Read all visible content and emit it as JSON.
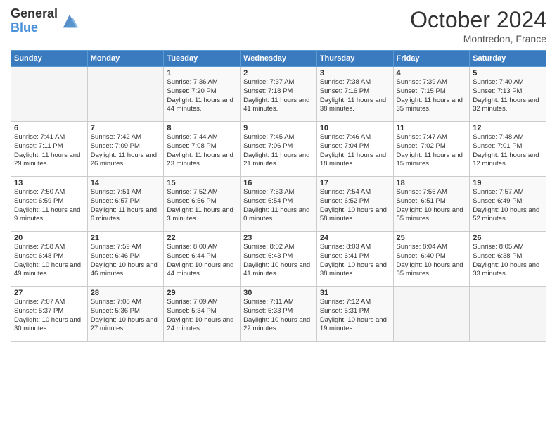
{
  "header": {
    "logo_general": "General",
    "logo_blue": "Blue",
    "title": "October 2024",
    "location": "Montredon, France"
  },
  "days_of_week": [
    "Sunday",
    "Monday",
    "Tuesday",
    "Wednesday",
    "Thursday",
    "Friday",
    "Saturday"
  ],
  "weeks": [
    [
      {
        "day": "",
        "sunrise": "",
        "sunset": "",
        "daylight": ""
      },
      {
        "day": "",
        "sunrise": "",
        "sunset": "",
        "daylight": ""
      },
      {
        "day": "1",
        "sunrise": "Sunrise: 7:36 AM",
        "sunset": "Sunset: 7:20 PM",
        "daylight": "Daylight: 11 hours and 44 minutes."
      },
      {
        "day": "2",
        "sunrise": "Sunrise: 7:37 AM",
        "sunset": "Sunset: 7:18 PM",
        "daylight": "Daylight: 11 hours and 41 minutes."
      },
      {
        "day": "3",
        "sunrise": "Sunrise: 7:38 AM",
        "sunset": "Sunset: 7:16 PM",
        "daylight": "Daylight: 11 hours and 38 minutes."
      },
      {
        "day": "4",
        "sunrise": "Sunrise: 7:39 AM",
        "sunset": "Sunset: 7:15 PM",
        "daylight": "Daylight: 11 hours and 35 minutes."
      },
      {
        "day": "5",
        "sunrise": "Sunrise: 7:40 AM",
        "sunset": "Sunset: 7:13 PM",
        "daylight": "Daylight: 11 hours and 32 minutes."
      }
    ],
    [
      {
        "day": "6",
        "sunrise": "Sunrise: 7:41 AM",
        "sunset": "Sunset: 7:11 PM",
        "daylight": "Daylight: 11 hours and 29 minutes."
      },
      {
        "day": "7",
        "sunrise": "Sunrise: 7:42 AM",
        "sunset": "Sunset: 7:09 PM",
        "daylight": "Daylight: 11 hours and 26 minutes."
      },
      {
        "day": "8",
        "sunrise": "Sunrise: 7:44 AM",
        "sunset": "Sunset: 7:08 PM",
        "daylight": "Daylight: 11 hours and 23 minutes."
      },
      {
        "day": "9",
        "sunrise": "Sunrise: 7:45 AM",
        "sunset": "Sunset: 7:06 PM",
        "daylight": "Daylight: 11 hours and 21 minutes."
      },
      {
        "day": "10",
        "sunrise": "Sunrise: 7:46 AM",
        "sunset": "Sunset: 7:04 PM",
        "daylight": "Daylight: 11 hours and 18 minutes."
      },
      {
        "day": "11",
        "sunrise": "Sunrise: 7:47 AM",
        "sunset": "Sunset: 7:02 PM",
        "daylight": "Daylight: 11 hours and 15 minutes."
      },
      {
        "day": "12",
        "sunrise": "Sunrise: 7:48 AM",
        "sunset": "Sunset: 7:01 PM",
        "daylight": "Daylight: 11 hours and 12 minutes."
      }
    ],
    [
      {
        "day": "13",
        "sunrise": "Sunrise: 7:50 AM",
        "sunset": "Sunset: 6:59 PM",
        "daylight": "Daylight: 11 hours and 9 minutes."
      },
      {
        "day": "14",
        "sunrise": "Sunrise: 7:51 AM",
        "sunset": "Sunset: 6:57 PM",
        "daylight": "Daylight: 11 hours and 6 minutes."
      },
      {
        "day": "15",
        "sunrise": "Sunrise: 7:52 AM",
        "sunset": "Sunset: 6:56 PM",
        "daylight": "Daylight: 11 hours and 3 minutes."
      },
      {
        "day": "16",
        "sunrise": "Sunrise: 7:53 AM",
        "sunset": "Sunset: 6:54 PM",
        "daylight": "Daylight: 11 hours and 0 minutes."
      },
      {
        "day": "17",
        "sunrise": "Sunrise: 7:54 AM",
        "sunset": "Sunset: 6:52 PM",
        "daylight": "Daylight: 10 hours and 58 minutes."
      },
      {
        "day": "18",
        "sunrise": "Sunrise: 7:56 AM",
        "sunset": "Sunset: 6:51 PM",
        "daylight": "Daylight: 10 hours and 55 minutes."
      },
      {
        "day": "19",
        "sunrise": "Sunrise: 7:57 AM",
        "sunset": "Sunset: 6:49 PM",
        "daylight": "Daylight: 10 hours and 52 minutes."
      }
    ],
    [
      {
        "day": "20",
        "sunrise": "Sunrise: 7:58 AM",
        "sunset": "Sunset: 6:48 PM",
        "daylight": "Daylight: 10 hours and 49 minutes."
      },
      {
        "day": "21",
        "sunrise": "Sunrise: 7:59 AM",
        "sunset": "Sunset: 6:46 PM",
        "daylight": "Daylight: 10 hours and 46 minutes."
      },
      {
        "day": "22",
        "sunrise": "Sunrise: 8:00 AM",
        "sunset": "Sunset: 6:44 PM",
        "daylight": "Daylight: 10 hours and 44 minutes."
      },
      {
        "day": "23",
        "sunrise": "Sunrise: 8:02 AM",
        "sunset": "Sunset: 6:43 PM",
        "daylight": "Daylight: 10 hours and 41 minutes."
      },
      {
        "day": "24",
        "sunrise": "Sunrise: 8:03 AM",
        "sunset": "Sunset: 6:41 PM",
        "daylight": "Daylight: 10 hours and 38 minutes."
      },
      {
        "day": "25",
        "sunrise": "Sunrise: 8:04 AM",
        "sunset": "Sunset: 6:40 PM",
        "daylight": "Daylight: 10 hours and 35 minutes."
      },
      {
        "day": "26",
        "sunrise": "Sunrise: 8:05 AM",
        "sunset": "Sunset: 6:38 PM",
        "daylight": "Daylight: 10 hours and 33 minutes."
      }
    ],
    [
      {
        "day": "27",
        "sunrise": "Sunrise: 7:07 AM",
        "sunset": "Sunset: 5:37 PM",
        "daylight": "Daylight: 10 hours and 30 minutes."
      },
      {
        "day": "28",
        "sunrise": "Sunrise: 7:08 AM",
        "sunset": "Sunset: 5:36 PM",
        "daylight": "Daylight: 10 hours and 27 minutes."
      },
      {
        "day": "29",
        "sunrise": "Sunrise: 7:09 AM",
        "sunset": "Sunset: 5:34 PM",
        "daylight": "Daylight: 10 hours and 24 minutes."
      },
      {
        "day": "30",
        "sunrise": "Sunrise: 7:11 AM",
        "sunset": "Sunset: 5:33 PM",
        "daylight": "Daylight: 10 hours and 22 minutes."
      },
      {
        "day": "31",
        "sunrise": "Sunrise: 7:12 AM",
        "sunset": "Sunset: 5:31 PM",
        "daylight": "Daylight: 10 hours and 19 minutes."
      },
      {
        "day": "",
        "sunrise": "",
        "sunset": "",
        "daylight": ""
      },
      {
        "day": "",
        "sunrise": "",
        "sunset": "",
        "daylight": ""
      }
    ]
  ]
}
